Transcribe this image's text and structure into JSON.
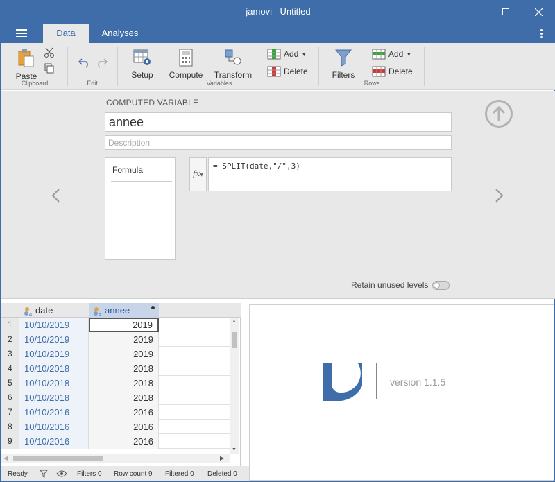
{
  "window": {
    "title": "jamovi - Untitled"
  },
  "tabs": [
    {
      "label": "Data"
    },
    {
      "label": "Analyses"
    }
  ],
  "ribbon": {
    "clipboard": {
      "paste": "Paste",
      "group": "Clipboard"
    },
    "edit": {
      "group": "Edit"
    },
    "variables": {
      "setup": "Setup",
      "compute": "Compute",
      "transform": "Transform",
      "add": "Add",
      "delete": "Delete",
      "group": "Variables"
    },
    "rows": {
      "filters": "Filters",
      "add": "Add",
      "delete": "Delete",
      "group": "Rows"
    }
  },
  "computed_variable": {
    "header": "COMPUTED VARIABLE",
    "name": "annee",
    "description_placeholder": "Description",
    "formula_label": "Formula",
    "fx": "fx",
    "formula": "= SPLIT(date,\"/\",3)",
    "retain_label": "Retain unused levels"
  },
  "grid": {
    "columns": [
      {
        "name": "date"
      },
      {
        "name": "annee"
      }
    ],
    "rows": [
      {
        "n": "1",
        "date": "10/10/2019",
        "annee": "2019"
      },
      {
        "n": "2",
        "date": "10/10/2019",
        "annee": "2019"
      },
      {
        "n": "3",
        "date": "10/10/2019",
        "annee": "2019"
      },
      {
        "n": "4",
        "date": "10/10/2018",
        "annee": "2018"
      },
      {
        "n": "5",
        "date": "10/10/2018",
        "annee": "2018"
      },
      {
        "n": "6",
        "date": "10/10/2018",
        "annee": "2018"
      },
      {
        "n": "7",
        "date": "10/10/2016",
        "annee": "2016"
      },
      {
        "n": "8",
        "date": "10/10/2016",
        "annee": "2016"
      },
      {
        "n": "9",
        "date": "10/10/2016",
        "annee": "2016"
      }
    ]
  },
  "results": {
    "version": "version 1.1.5"
  },
  "status": {
    "ready": "Ready",
    "filters": "Filters 0",
    "row_count": "Row count 9",
    "filtered": "Filtered 0",
    "deleted": "Deleted 0"
  },
  "colors": {
    "brand": "#3e6da9",
    "ribbon": "#e8e8e8"
  }
}
